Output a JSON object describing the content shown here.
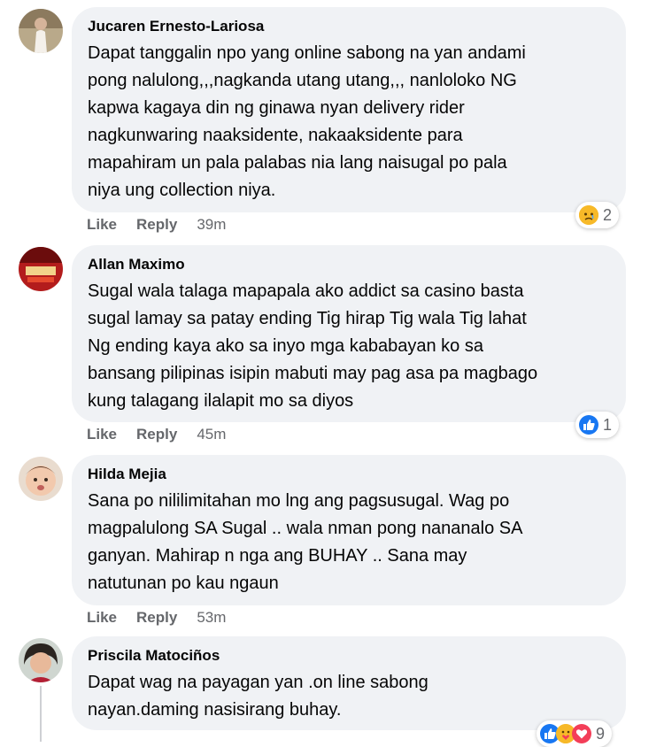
{
  "comments": [
    {
      "author": "Jucaren Ernesto-Lariosa",
      "lines": [
        "Dapat tanggalin npo yang online sabong na yan andami",
        "pong nalulong,,,nagkanda utang utang,,, nanloloko NG",
        "kapwa kagaya din ng ginawa nyan delivery rider",
        "nagkunwaring naaksidente, nakaaksidente para",
        "mapahiram un pala palabas nia lang naisugal po pala",
        "niya ung collection niya."
      ],
      "like": "Like",
      "reply": "Reply",
      "time": "39m",
      "reaction_icon": "sad-emoji-icon",
      "reaction_count": "2"
    },
    {
      "author": "Allan Maximo",
      "lines": [
        "Sugal wala talaga mapapala ako addict sa casino basta",
        "sugal lamay sa patay ending Tig hirap Tig wala Tig lahat",
        "Ng ending kaya ako sa inyo mga kababayan ko sa",
        "bansang pilipinas isipin mabuti may pag asa pa magbago",
        "kung talagang ilalapit mo sa diyos"
      ],
      "like": "Like",
      "reply": "Reply",
      "time": "45m",
      "reaction_icon": "thumbs-up-icon",
      "reaction_count": "1"
    },
    {
      "author": "Hilda Mejia",
      "lines": [
        "Sana po nililimitahan mo lng ang pagsusugal. Wag po",
        "magpalulong SA Sugal .. wala nman pong nananalo SA",
        "ganyan. Mahirap n nga ang BUHAY .. Sana may",
        "natutunan po kau ngaun"
      ],
      "like": "Like",
      "reply": "Reply",
      "time": "53m"
    },
    {
      "author": "Priscila Matociños",
      "lines": [
        "Dapat wag na payagan yan .on line sabong",
        "nayan.daming nasisirang buhay."
      ],
      "reaction_icons": [
        "thumbs-up-icon",
        "care-emoji-icon",
        "heart-icon"
      ],
      "reaction_count": "9"
    }
  ],
  "colors": {
    "bubble": "#f0f2f5",
    "meta": "#65676b",
    "like_blue": "#1877f2",
    "sad_yellow": "#f7b928",
    "heart_red": "#f33e58"
  }
}
